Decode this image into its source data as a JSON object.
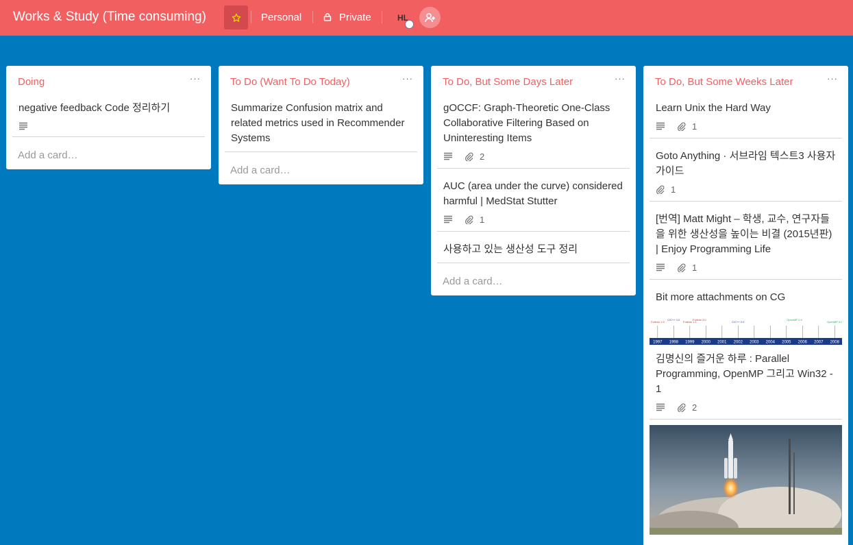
{
  "header": {
    "title": "Works & Study (Time consuming)",
    "team": "Personal",
    "visibility": "Private",
    "member_initials": "HL"
  },
  "colors": {
    "header": "#f15f61",
    "board_bg": "#0079bf",
    "list_title": "#f15f61"
  },
  "lists": [
    {
      "title": "Doing",
      "cards": [
        {
          "title": "negative feedback Code 정리하기",
          "has_description": true
        }
      ],
      "add_label": "Add a card…"
    },
    {
      "title": "To Do (Want To Do Today)",
      "cards": [
        {
          "title": "Summarize Confusion matrix and related metrics used in Recommender Systems"
        }
      ],
      "add_label": "Add a card…"
    },
    {
      "title": "To Do, But Some Days Later",
      "cards": [
        {
          "title": "gOCCF: Graph-Theoretic One-Class Collaborative Filtering Based on Uninteresting Items",
          "has_description": true,
          "attachments": "2"
        },
        {
          "title": "AUC (area under the curve) considered harmful | MedStat Stutter",
          "has_description": true,
          "attachments": "1"
        },
        {
          "title": "사용하고 있는 생산성 도구 정리"
        }
      ],
      "add_label": "Add a card…"
    },
    {
      "title": "To Do, But Some Weeks Later",
      "cards": [
        {
          "title": "Learn Unix the Hard Way",
          "has_description": true,
          "attachments": "1"
        },
        {
          "title": "Goto Anything · 서브라임 텍스트3 사용자 가이드",
          "attachments": "1"
        },
        {
          "title": "[번역] Matt Might – 학생, 교수, 연구자들을 위한 생산성을 높이는 비결 (2015년판) | Enjoy Programming Life",
          "has_description": true,
          "attachments": "1"
        },
        {
          "title": "Bit more attachments on CG"
        },
        {
          "title": "김명신의 즐거운 하루 : Parallel Programming, OpenMP 그리고 Win32 - 1",
          "has_description": true,
          "attachments": "2",
          "cover_timeline": {
            "years": [
              "1997",
              "1998",
              "1999",
              "2000",
              "2001",
              "2002",
              "2003",
              "2004",
              "2005",
              "2006",
              "2007",
              "2008"
            ],
            "releases": [
              "Fortran 1.0",
              "C/C++ 1.0",
              "Fortran 1.1",
              "Fortran 2.0",
              "C/C++ 2.0",
              "OpenMP 2.5",
              "OpenMP 3.0"
            ]
          }
        }
      ]
    }
  ]
}
